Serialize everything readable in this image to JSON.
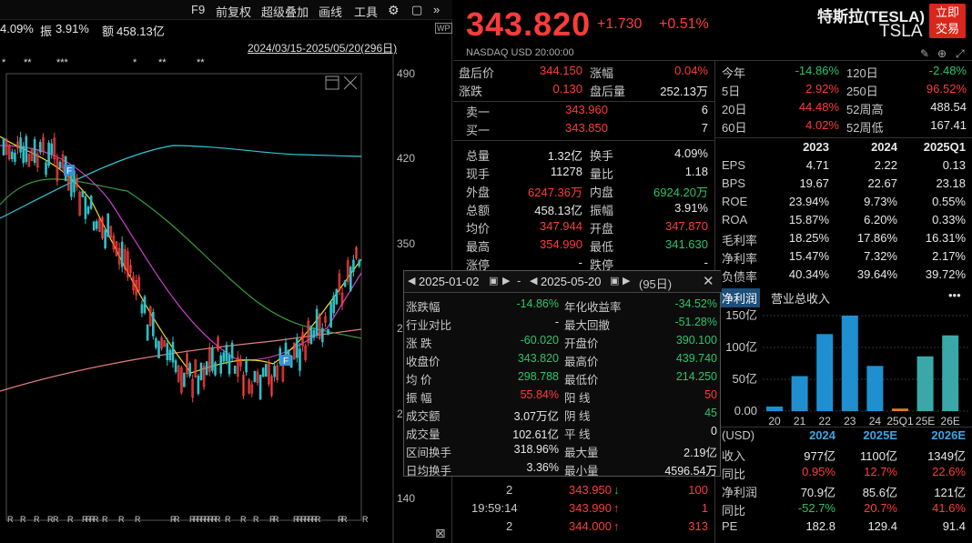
{
  "toolbar": {
    "f9": "F9",
    "fq": "前复权",
    "overlay": "超级叠加",
    "draw": "画线",
    "tools": "工具"
  },
  "statsline": {
    "a": "4.09%",
    "b_label": "振",
    "b_val": "3.91%",
    "c_label": "额",
    "c_val": "458.13亿"
  },
  "range": "2024/03/15-2025/05/20(296日)",
  "axis": {
    "p490": "490",
    "p420": "420",
    "p350": "350",
    "p280": "2",
    "p210": "2",
    "p140": "140"
  },
  "markers": {
    "star": "*",
    "dstar": "**",
    "tstar": "***",
    "f": "F",
    "r": "R"
  },
  "quote": {
    "price": "343.820",
    "change": "+1.730",
    "pct": "+0.51%",
    "name": "特斯拉(TESLA)",
    "ticker": "TSLA",
    "trade": "立即交易",
    "market": "NASDAQ  USD  20:00:00"
  },
  "post": [
    {
      "l": "盘后价",
      "v": "344.150",
      "l2": "涨幅",
      "v2": "0.04%",
      "c": "red",
      "c2": "red"
    },
    {
      "l": "涨跌",
      "v": "0.130",
      "l2": "盘后量",
      "v2": "252.13万",
      "c": "red",
      "c2": "white"
    }
  ],
  "book": [
    {
      "l": "卖一",
      "v": "343.960",
      "q": "6"
    },
    {
      "l": "买一",
      "v": "343.850",
      "q": "7"
    }
  ],
  "stats": [
    {
      "l": "总量",
      "v": "1.32亿",
      "c": "white",
      "l2": "换手",
      "v2": "4.09%",
      "c2": "white"
    },
    {
      "l": "现手",
      "v": "11278",
      "c": "white",
      "l2": "量比",
      "v2": "1.18",
      "c2": "white"
    },
    {
      "l": "外盘",
      "v": "6247.36万",
      "c": "red",
      "l2": "内盘",
      "v2": "6924.20万",
      "c2": "green"
    },
    {
      "l": "总额",
      "v": "458.13亿",
      "c": "white",
      "l2": "振幅",
      "v2": "3.91%",
      "c2": "white"
    },
    {
      "l": "均价",
      "v": "347.944",
      "c": "red",
      "l2": "开盘",
      "v2": "347.870",
      "c2": "red"
    },
    {
      "l": "最高",
      "v": "354.990",
      "c": "red",
      "l2": "最低",
      "v2": "341.630",
      "c2": "green"
    },
    {
      "l": "涨停",
      "v": "-",
      "c": "white",
      "l2": "跌停",
      "v2": "-",
      "c2": "white"
    }
  ],
  "perf": [
    {
      "l": "今年",
      "v": "-14.86%",
      "c": "green",
      "l2": "120日",
      "v2": "-2.48%",
      "c2": "green"
    },
    {
      "l": "5日",
      "v": "2.92%",
      "c": "red",
      "l2": "250日",
      "v2": "96.52%",
      "c2": "red"
    },
    {
      "l": "20日",
      "v": "44.48%",
      "c": "red",
      "l2": "52周高",
      "v2": "488.54",
      "c2": "white"
    },
    {
      "l": "60日",
      "v": "4.02%",
      "c": "red",
      "l2": "52周低",
      "v2": "167.41",
      "c2": "white"
    }
  ],
  "fin": {
    "years": [
      "2023",
      "2024",
      "2025Q1"
    ],
    "rows": [
      {
        "l": "EPS",
        "v": [
          "4.71",
          "2.22",
          "0.13"
        ]
      },
      {
        "l": "BPS",
        "v": [
          "19.67",
          "22.67",
          "23.18"
        ]
      },
      {
        "l": "ROE",
        "v": [
          "23.94%",
          "9.73%",
          "0.55%"
        ]
      },
      {
        "l": "ROA",
        "v": [
          "15.87%",
          "6.20%",
          "0.33%"
        ]
      },
      {
        "l": "毛利率",
        "v": [
          "18.25%",
          "17.86%",
          "16.31%"
        ]
      },
      {
        "l": "净利率",
        "v": [
          "15.47%",
          "7.32%",
          "2.17%"
        ]
      },
      {
        "l": "负债率",
        "v": [
          "40.34%",
          "39.64%",
          "39.72%"
        ]
      }
    ]
  },
  "tabs": {
    "t1": "净利润",
    "t2": "营业总收入",
    "more": "•••"
  },
  "bar_chart": {
    "ylabels": [
      "150亿",
      "100亿",
      "50亿",
      "0.00"
    ],
    "categories": [
      "20",
      "21",
      "22",
      "23",
      "24",
      "25Q1",
      "25E",
      "26E"
    ],
    "values": [
      7.2,
      55,
      121,
      150,
      71,
      4,
      86,
      119
    ],
    "ymax": 150
  },
  "forecast": {
    "unit": "(USD)",
    "years": [
      "2024",
      "2025E",
      "2026E"
    ],
    "rows": [
      {
        "l": "收入",
        "v": [
          "977亿",
          "1100亿",
          "1349亿"
        ],
        "c": [
          "white",
          "white",
          "white"
        ]
      },
      {
        "l": "同比",
        "v": [
          "0.95%",
          "12.7%",
          "22.6%"
        ],
        "c": [
          "red",
          "red",
          "red"
        ]
      },
      {
        "l": "净利润",
        "v": [
          "70.9亿",
          "85.6亿",
          "121亿"
        ],
        "c": [
          "white",
          "white",
          "white"
        ]
      },
      {
        "l": "同比",
        "v": [
          "-52.7%",
          "20.7%",
          "41.6%"
        ],
        "c": [
          "green",
          "red",
          "red"
        ]
      },
      {
        "l": "PE",
        "v": [
          "182.8",
          "129.4",
          "91.4"
        ],
        "c": [
          "white",
          "white",
          "white"
        ]
      }
    ]
  },
  "ticks": [
    {
      "t": "2",
      "p": "343.950",
      "d": "↓",
      "q": "100",
      "pc": "red",
      "dc": "green"
    },
    {
      "t": "19:59:14",
      "p": "343.990",
      "d": "↑",
      "q": "1",
      "pc": "red",
      "dc": "red"
    },
    {
      "t": "2",
      "p": "344.000",
      "d": "↑",
      "q": "313",
      "pc": "red",
      "dc": "red"
    }
  ],
  "popup": {
    "d1": "2025-01-02",
    "dash": "-",
    "d2": "2025-05-20",
    "days": "(95日)",
    "rows": [
      {
        "l": "涨跌幅",
        "v": "-14.86%",
        "c": "green",
        "l2": "年化收益率",
        "v2": "-34.52%",
        "c2": "green"
      },
      {
        "l": "行业对比",
        "v": "-",
        "c": "white",
        "l2": "最大回撤",
        "v2": "-51.28%",
        "c2": "green"
      },
      {
        "l": "涨  跌",
        "v": "-60.020",
        "c": "green",
        "l2": "开盘价",
        "v2": "390.100",
        "c2": "green"
      },
      {
        "l": "收盘价",
        "v": "343.820",
        "c": "green",
        "l2": "最高价",
        "v2": "439.740",
        "c2": "green"
      },
      {
        "l": "均  价",
        "v": "298.788",
        "c": "green",
        "l2": "最低价",
        "v2": "214.250",
        "c2": "green"
      },
      {
        "l": "振  幅",
        "v": "55.84%",
        "c": "red",
        "l2": "阳  线",
        "v2": "50",
        "c2": "red"
      },
      {
        "l": "成交额",
        "v": "3.07万亿",
        "c": "white",
        "l2": "阴  线",
        "v2": "45",
        "c2": "green"
      },
      {
        "l": "成交量",
        "v": "102.61亿",
        "c": "white",
        "l2": "平  线",
        "v2": "0",
        "c2": "white"
      },
      {
        "l": "区间换手",
        "v": "318.96%",
        "c": "white",
        "l2": "最大量",
        "v2": "2.19亿",
        "c2": "white"
      },
      {
        "l": "日均换手",
        "v": "3.36%",
        "c": "white",
        "l2": "最小量",
        "v2": "4596.54万",
        "c2": "white"
      }
    ]
  }
}
